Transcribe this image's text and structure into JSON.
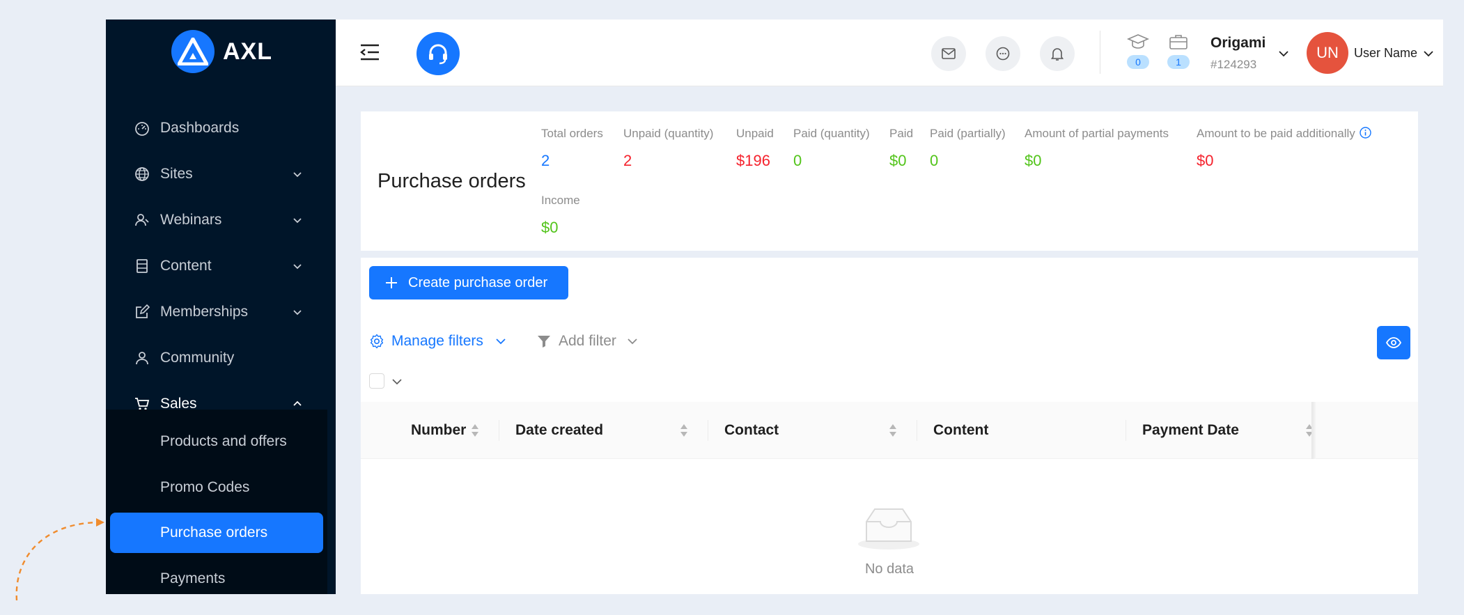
{
  "brand": {
    "name": "AXL",
    "color": "#1677ff"
  },
  "sidebar": {
    "items": [
      {
        "label": "Dashboards",
        "icon": "dashboard-icon"
      },
      {
        "label": "Sites",
        "icon": "globe-icon"
      },
      {
        "label": "Webinars",
        "icon": "webinar-icon"
      },
      {
        "label": "Content",
        "icon": "content-icon"
      },
      {
        "label": "Memberships",
        "icon": "edit-icon"
      },
      {
        "label": "Community",
        "icon": "user-icon"
      },
      {
        "label": "Sales",
        "icon": "cart-icon"
      }
    ],
    "sales_submenu": [
      {
        "label": "Products and offers"
      },
      {
        "label": "Promo Codes"
      },
      {
        "label": "Purchase orders",
        "selected": true
      },
      {
        "label": "Payments"
      }
    ]
  },
  "header": {
    "courses_count": "0",
    "cases_count": "1",
    "org_name": "Origami",
    "org_id": "#124293",
    "avatar_initials": "UN",
    "user_name": "User Name",
    "avatar_color": "#e5533d"
  },
  "stats": {
    "title": "Purchase orders",
    "items": [
      {
        "label": "Total orders",
        "value": "2",
        "color": "blue"
      },
      {
        "label": "Unpaid (quantity)",
        "value": "2",
        "color": "red"
      },
      {
        "label": "Unpaid",
        "value": "$196",
        "color": "red"
      },
      {
        "label": "Paid (quantity)",
        "value": "0",
        "color": "green"
      },
      {
        "label": "Paid",
        "value": "$0",
        "color": "green"
      },
      {
        "label": "Paid (partially)",
        "value": "0",
        "color": "green"
      },
      {
        "label": "Amount of partial payments",
        "value": "$0",
        "color": "green"
      },
      {
        "label": "Amount to be paid additionally",
        "value": "$0",
        "color": "red"
      },
      {
        "label": "Income",
        "value": "$0",
        "color": "green"
      }
    ]
  },
  "toolbar": {
    "create_label": "Create purchase order",
    "manage_filters_label": "Manage filters",
    "add_filter_label": "Add filter"
  },
  "table": {
    "columns": [
      "Number",
      "Date created",
      "Contact",
      "Content",
      "Payment Date"
    ],
    "empty_text": "No data"
  }
}
